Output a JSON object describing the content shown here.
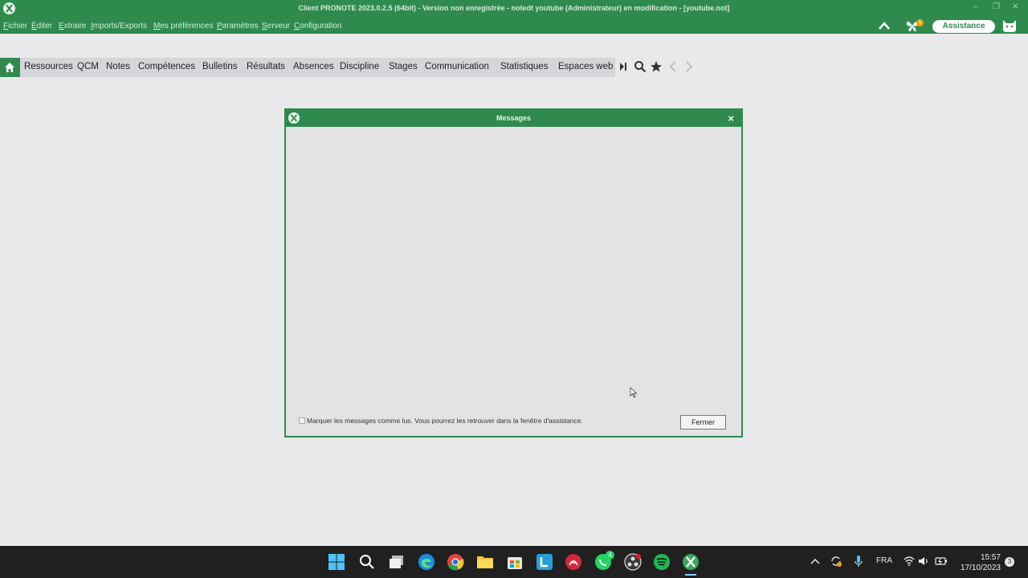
{
  "titlebar": {
    "title": "Client PRONOTE 2023.0.2.5 (64bit) - Version non enregistrée  - notedt youtube (Administrateur) en modification - [youtube.not]",
    "controls": [
      "–",
      "❐",
      "✕"
    ]
  },
  "menu": [
    {
      "hot": "F",
      "rest": "ichier"
    },
    {
      "hot": "É",
      "rest": "diter"
    },
    {
      "hot": "E",
      "rest": "xtraire"
    },
    {
      "hot": "I",
      "rest": "mports/Exports"
    },
    {
      "hot": "M",
      "rest": "es préférences"
    },
    {
      "hot": "P",
      "rest": "aramètres"
    },
    {
      "hot": "S",
      "rest": "erveur"
    },
    {
      "hot": "C",
      "rest": "onfiguration"
    }
  ],
  "header_right": {
    "badge": "1",
    "assistance_label": "Assistance"
  },
  "nav": {
    "items": [
      "Ressources",
      "QCM",
      "Notes",
      "Compétences",
      "Bulletins",
      "Résultats",
      "Absences",
      "Discipline",
      "Stages",
      "Communication",
      "Statistiques",
      "Espaces web"
    ]
  },
  "dialog": {
    "title": "Messages",
    "checkbox_label": "Marquer les messages comme lus. Vous pourrez les retrouver dans la fenêtre d'assistance.",
    "checkbox_checked": false,
    "close_button": "Fermer"
  },
  "taskbar": {
    "whatsapp_badge": "4",
    "language": "FRA",
    "time": "15:57",
    "date": "17/10/2023",
    "notifications": "3"
  },
  "colors": {
    "brand_green": "#2f8a4e",
    "background": "#e9e9ec",
    "taskbar": "#202020"
  }
}
